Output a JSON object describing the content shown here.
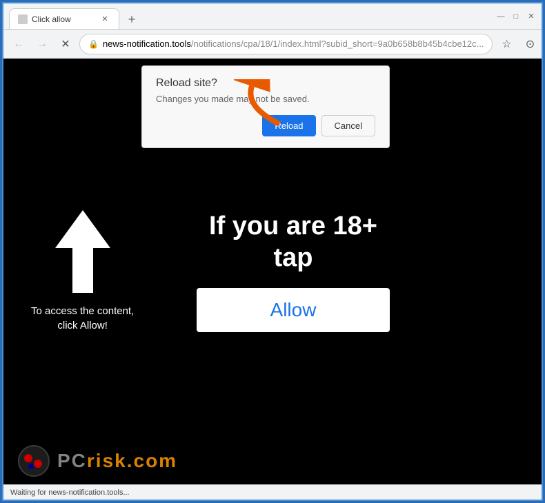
{
  "window": {
    "border_color": "#2a6db5"
  },
  "title_bar": {
    "tab_title": "Click allow",
    "new_tab_icon": "+",
    "minimize_icon": "—",
    "maximize_icon": "□",
    "close_icon": "✕"
  },
  "address_bar": {
    "url_domain": "news-notification.tools",
    "url_path": "/notifications/cpa/18/1/index.html?subid_short=9a0b658b8b45b4cbe12c...",
    "back_icon": "←",
    "forward_icon": "→",
    "refresh_icon": "✕",
    "star_icon": "☆",
    "profile_icon": "⊙",
    "menu_icon": "⋮"
  },
  "dialog": {
    "title": "Reload site?",
    "message": "Changes you made may not be saved.",
    "reload_label": "Reload",
    "cancel_label": "Cancel"
  },
  "page_content": {
    "main_text_line1": "If you are 18+",
    "main_text_line2": "tap",
    "allow_button_label": "Allow",
    "left_label_line1": "To access the content,",
    "left_label_line2": "click Allow!"
  },
  "status_bar": {
    "text": "Waiting for news-notification.tools..."
  },
  "watermark": {
    "text_gray": "PC",
    "text_orange": "risk.com"
  }
}
